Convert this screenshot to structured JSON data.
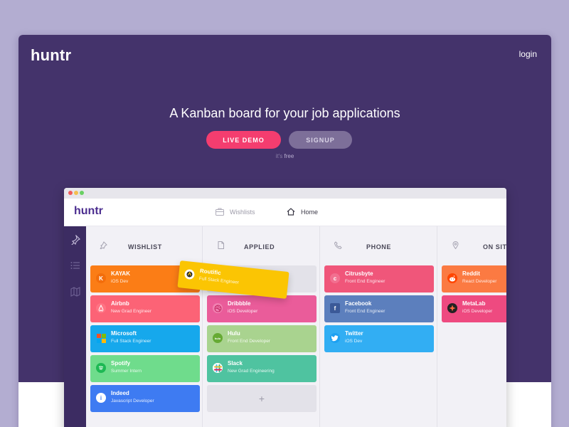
{
  "site": {
    "logo": "huntr",
    "login": "login"
  },
  "hero": {
    "tagline": "A Kanban board for your job applications",
    "demo_button": "LIVE DEMO",
    "signup_button": "SIGNUP",
    "free_prefix": "it's",
    "free_word": "free"
  },
  "app": {
    "logo": "huntr",
    "nav": {
      "wishlists": "Wishlists",
      "home": "Home"
    },
    "columns": [
      {
        "title": "WISHLIST",
        "icon": "pin-icon"
      },
      {
        "title": "APPLIED",
        "icon": "document-icon"
      },
      {
        "title": "PHONE",
        "icon": "phone-icon"
      },
      {
        "title": "ON SITE",
        "icon": "location-pin-icon"
      }
    ],
    "wishlist": [
      {
        "company": "KAYAK",
        "role": "iOS Dev",
        "color": "#fb7d16",
        "icon": "K"
      },
      {
        "company": "Airbnb",
        "role": "New Grad Engineer",
        "color": "#fc6376",
        "icon": "airbnb-icon"
      },
      {
        "company": "Microsoft",
        "role": "Full Stack Engineer",
        "color": "#16a8ec",
        "icon": "microsoft-icon"
      },
      {
        "company": "Spotify",
        "role": "Summer Intern",
        "color": "#6fdc8c",
        "icon": "spotify-icon"
      },
      {
        "company": "Indeed",
        "role": "Javascript Developer",
        "color": "#3e7bf2",
        "icon": "i"
      }
    ],
    "dragging": {
      "company": "Routific",
      "role": "Full Stack Engineer",
      "color": "#fbc503"
    },
    "applied": [
      {
        "company": "Dribbble",
        "role": "iOS Developer",
        "color": "#ea5c9a",
        "icon": "dribbble-icon"
      },
      {
        "company": "Hulu",
        "role": "Front End Developer",
        "color": "#a9d38f",
        "icon": "hulu-icon"
      },
      {
        "company": "Slack",
        "role": "New Grad Engineering",
        "color": "#4fc3a0",
        "icon": "slack-icon"
      }
    ],
    "add_card": "+",
    "phone": [
      {
        "company": "Citrusbyte",
        "role": "Front End Engineer",
        "color": "#f0567a",
        "icon": "citrusbyte-icon"
      },
      {
        "company": "Facebook",
        "role": "Front End Engineer",
        "color": "#5c7fbd",
        "icon": "f"
      },
      {
        "company": "Twitter",
        "role": "iOS Dev",
        "color": "#32aef3",
        "icon": "twitter-icon"
      }
    ],
    "onsite": [
      {
        "company": "Reddit",
        "role": "React Developer",
        "color": "#fb7a42",
        "icon": "reddit-icon"
      },
      {
        "company": "MetaLab",
        "role": "iOS Developer",
        "color": "#ee4a80",
        "icon": "metalab-icon"
      }
    ]
  }
}
